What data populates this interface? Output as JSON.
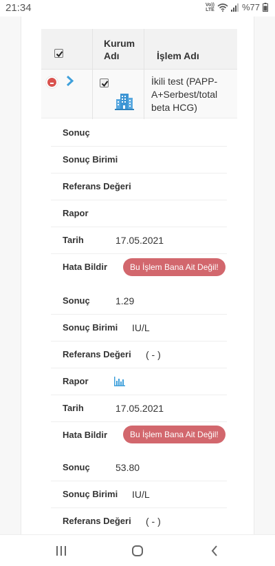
{
  "status": {
    "time": "21:34",
    "volte_top": "Vo))",
    "volte_bottom": "LTE",
    "battery": "%77"
  },
  "table": {
    "headers": {
      "institution_line1": "Kurum",
      "institution_line2": "Adı",
      "procedure": "İşlem Adı"
    },
    "row": {
      "procedure_name": "İkili test (PAPP-A+Serbest/total beta HCG)"
    }
  },
  "groups": [
    {
      "result_label": "Sonuç",
      "result_value": "",
      "unit_label": "Sonuç Birimi",
      "unit_value": "",
      "ref_label": "Referans Değeri",
      "ref_value": "",
      "report_label": "Rapor",
      "date_label": "Tarih",
      "date_value": "17.05.2021",
      "error_label": "Hata Bildir",
      "error_button": "Bu İşlem Bana Ait Değil!"
    },
    {
      "result_label": "Sonuç",
      "result_value": "1.29",
      "unit_label": "Sonuç Birimi",
      "unit_value": "IU/L",
      "ref_label": "Referans Değeri",
      "ref_value": "( - )",
      "report_label": "Rapor",
      "date_label": "Tarih",
      "date_value": "17.05.2021",
      "error_label": "Hata Bildir",
      "error_button": "Bu İşlem Bana Ait Değil!"
    },
    {
      "result_label": "Sonuç",
      "result_value": "53.80",
      "unit_label": "Sonuç Birimi",
      "unit_value": "IU/L",
      "ref_label": "Referans Değeri",
      "ref_value": "( - )"
    }
  ],
  "colors": {
    "danger": "#d9534f",
    "error_button": "#d2676d",
    "accent": "#3fa0db"
  },
  "icons": [
    "minus-circle-icon",
    "chevron-right-icon",
    "building-icon",
    "bar-chart-icon",
    "wifi-icon",
    "signal-icon",
    "battery-icon",
    "recent-apps-icon",
    "home-icon",
    "back-icon"
  ]
}
